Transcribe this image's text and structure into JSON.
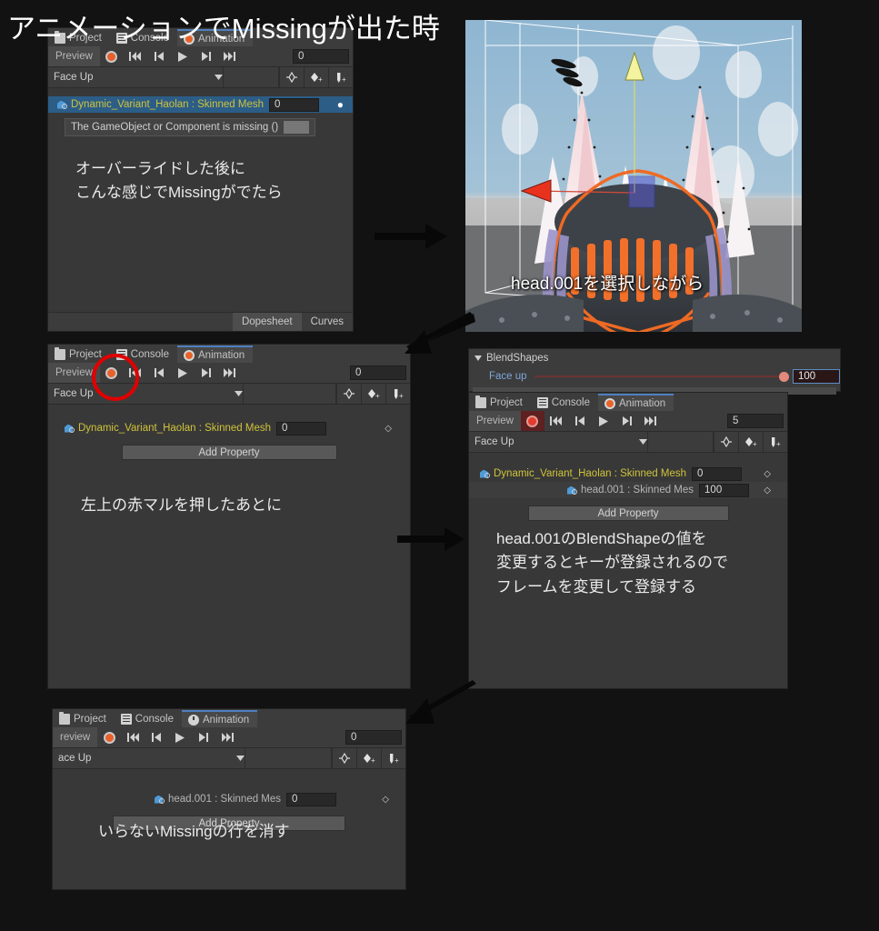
{
  "title": "アニメーションでMissingが出た時",
  "tabs": {
    "project": "Project",
    "console": "Console",
    "animation": "Animation"
  },
  "toolbar": {
    "preview": "Preview",
    "preview_clipped": "review",
    "record_icon": "record-icon",
    "first_key_icon": "skip-to-start-icon",
    "prev_key_icon": "prev-keyframe-icon",
    "play_icon": "play-icon",
    "next_key_icon": "next-keyframe-icon",
    "last_key_icon": "skip-to-end-icon",
    "add_keyframe_icon": "add-keyframe-icon",
    "add_key_marker_icon": "add-key-marker-icon",
    "add_event_icon": "add-event-icon"
  },
  "clip": {
    "name": "Face Up",
    "name_clipped": "ace Up",
    "caret_icon": "chevron-down-icon"
  },
  "buttons": {
    "add_property": "Add Property"
  },
  "bottom_tabs": {
    "dopesheet": "Dopesheet",
    "curves": "Curves"
  },
  "panel1": {
    "frame": "0",
    "row": {
      "name": "Dynamic_Variant_Haolan : Skinned Mesh",
      "value": "0"
    },
    "tooltip": "The GameObject or Component is missing ()",
    "caption": "オーバーライドした後に\nこんな感じでMissingがでたら"
  },
  "viewport": {
    "caption": "head.001を選択しながら"
  },
  "panel2": {
    "frame": "0",
    "row": {
      "name": "Dynamic_Variant_Haolan : Skinned Mesh",
      "value": "0"
    },
    "caption": "左上の赤マルを押したあとに"
  },
  "inspector": {
    "section": "BlendShapes",
    "property": "Face up",
    "value": "100",
    "collapse_icon": "triangle-down-icon"
  },
  "panel3": {
    "frame": "5",
    "rows": [
      {
        "name": "Dynamic_Variant_Haolan : Skinned Mesh",
        "value": "0",
        "style": "highlight"
      },
      {
        "name": "head.001 : Skinned Mes",
        "value": "100",
        "style": "dim"
      }
    ],
    "caption": "head.001のBlendShapeの値を\n変更するとキーが登録されるので\nフレームを変更して登録する"
  },
  "panel4": {
    "frame": "0",
    "row": {
      "name": "head.001 : Skinned Mes",
      "value": "0"
    },
    "caption": "いらないMissingの行を消す"
  },
  "annotations": {
    "red_circle": "record-button-highlight",
    "arrow_right_top": "arrow-right",
    "arrow_downleft_top": "arrow-down-left",
    "arrow_right_mid": "arrow-right",
    "arrow_downleft_bottom": "arrow-down-left"
  },
  "colors": {
    "panel_bg": "#383838",
    "toolbar_bg": "#3c3c3c",
    "selected_row": "#2c5d87",
    "property_yellow": "#cfc33a",
    "record_red": "#e8602c",
    "annotation_red": "#e00000",
    "tab_accent": "#4e7fbf"
  }
}
